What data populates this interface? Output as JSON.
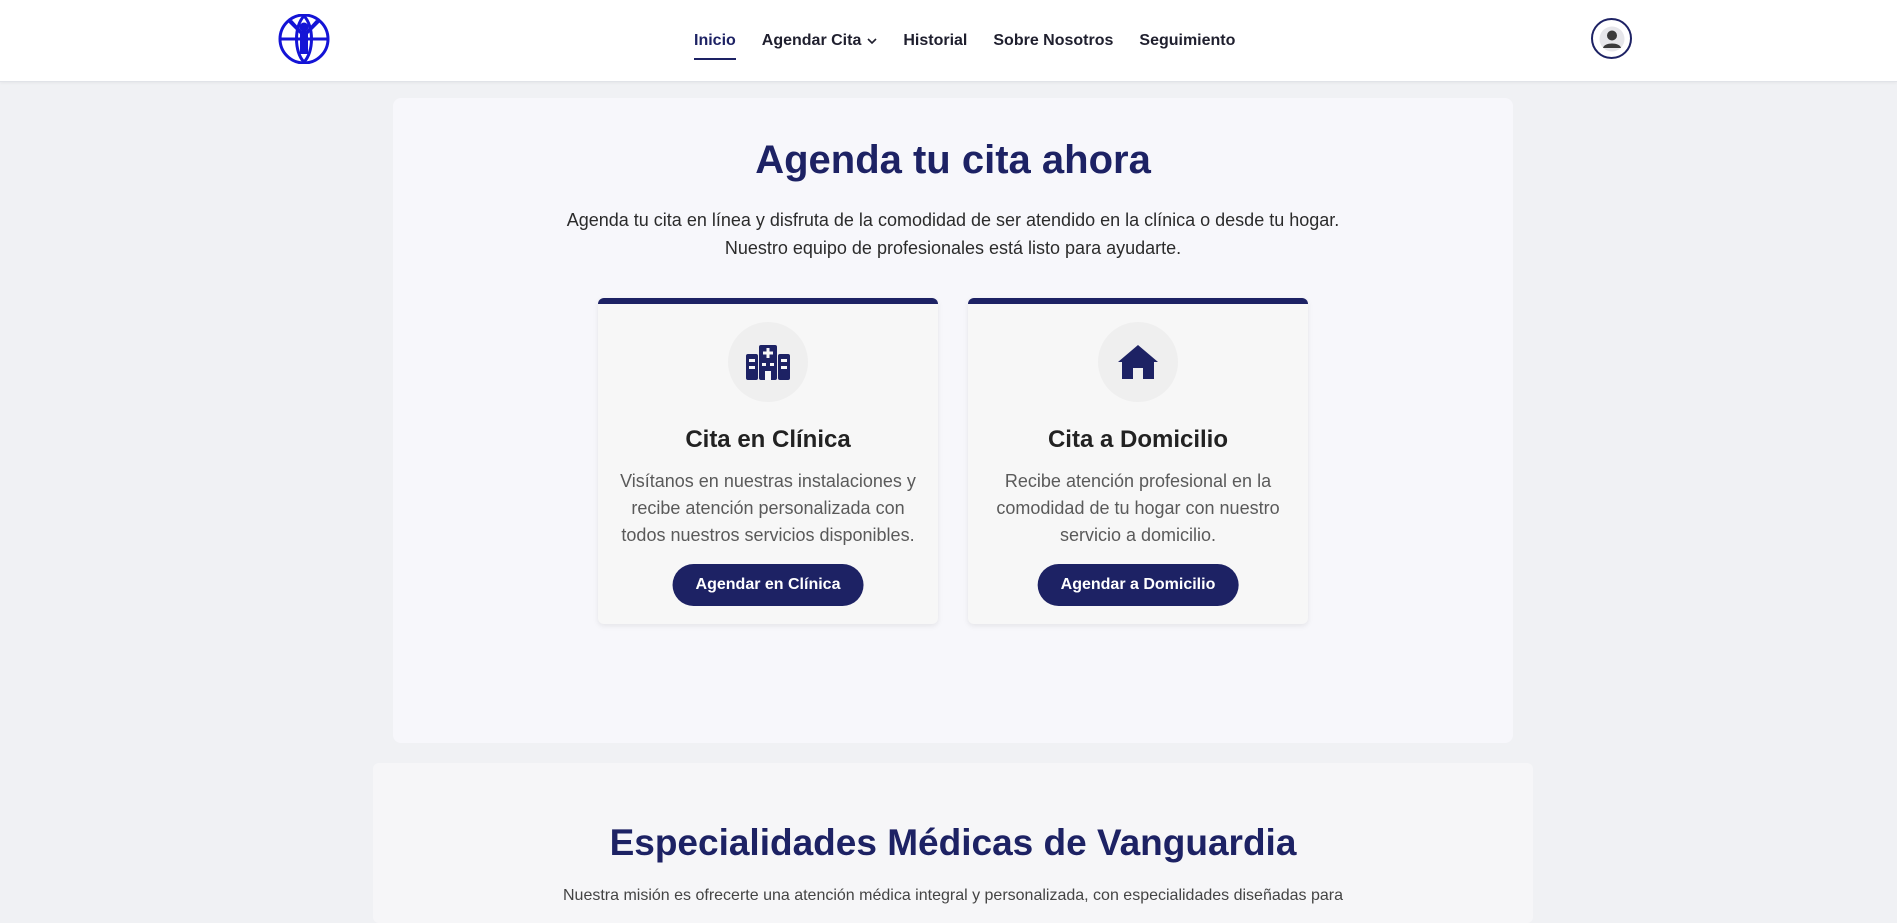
{
  "header": {
    "nav": [
      {
        "label": "Inicio",
        "active": true
      },
      {
        "label": "Agendar Cita",
        "has_dropdown": true
      },
      {
        "label": "Historial"
      },
      {
        "label": "Sobre Nosotros"
      },
      {
        "label": "Seguimiento"
      }
    ],
    "logo_icon": "person-globe-logo",
    "avatar_icon": "user-icon"
  },
  "hero": {
    "title": "Agenda tu cita ahora",
    "description_line1": "Agenda tu cita en línea y disfruta de la comodidad de ser atendido en la clínica o desde tu hogar.",
    "description_line2": "Nuestro equipo de profesionales está listo para ayudarte."
  },
  "cards": {
    "clinic": {
      "icon": "hospital-icon",
      "title": "Cita en Clínica",
      "description": "Visítanos en nuestras instalaciones y recibe atención personalizada con todos nuestros servicios disponibles.",
      "button": "Agendar en Clínica"
    },
    "home": {
      "icon": "house-icon",
      "title": "Cita a Domicilio",
      "description": "Recibe atención profesional en la comodidad de tu hogar con nuestro servicio a domicilio.",
      "button": "Agendar a Domicilio"
    }
  },
  "specialties": {
    "title": "Especialidades Médicas de Vanguardia",
    "description": "Nuestra misión es ofrecerte una atención médica integral y personalizada, con especialidades diseñadas para"
  },
  "colors": {
    "primary": "#1d2264",
    "logo_blue": "#1414d6",
    "page_bg": "#f0f1f4"
  }
}
